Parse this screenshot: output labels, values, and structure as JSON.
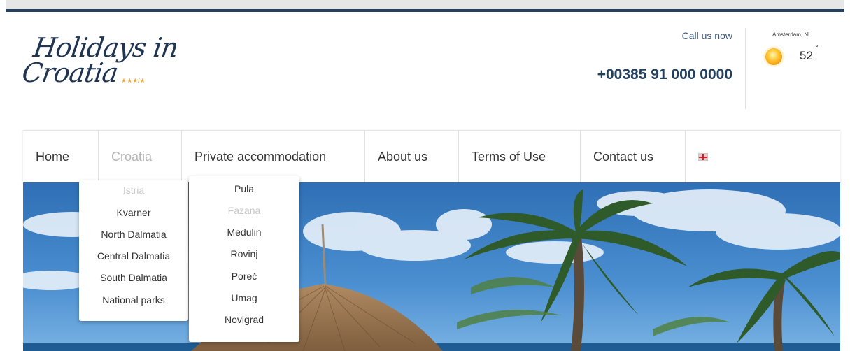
{
  "header": {
    "logo": {
      "line1": "Holidays in",
      "line2": "Croatia",
      "stars": "★★★/★"
    },
    "call_label": "Call us now",
    "phone": "+00385 91 000 0000",
    "weather": {
      "location": "Amsterdam, NL",
      "temperature": "52",
      "degree": "°",
      "icon": "sun-icon"
    }
  },
  "nav": {
    "items": [
      {
        "label": "Home"
      },
      {
        "label": "Croatia",
        "state": "active"
      },
      {
        "label": "Private accommodation"
      },
      {
        "label": "About us"
      },
      {
        "label": "Terms of Use"
      },
      {
        "label": "Contact us"
      }
    ],
    "language_icon": "flag-icon"
  },
  "dropdowns": {
    "croatia": [
      "Istria",
      "Kvarner",
      "North Dalmatia",
      "Central Dalmatia",
      "South Dalmatia",
      "National parks"
    ],
    "croatia_active": "Istria",
    "istria": [
      "Pula",
      "Fazana",
      "Medulin",
      "Rovinj",
      "Poreč",
      "Umag",
      "Novigrad"
    ],
    "istria_active": "Fazana"
  },
  "colors": {
    "brand_navy": "#24405f",
    "accent_orange": "#e9a23a",
    "muted_text": "#b4b4b4"
  }
}
